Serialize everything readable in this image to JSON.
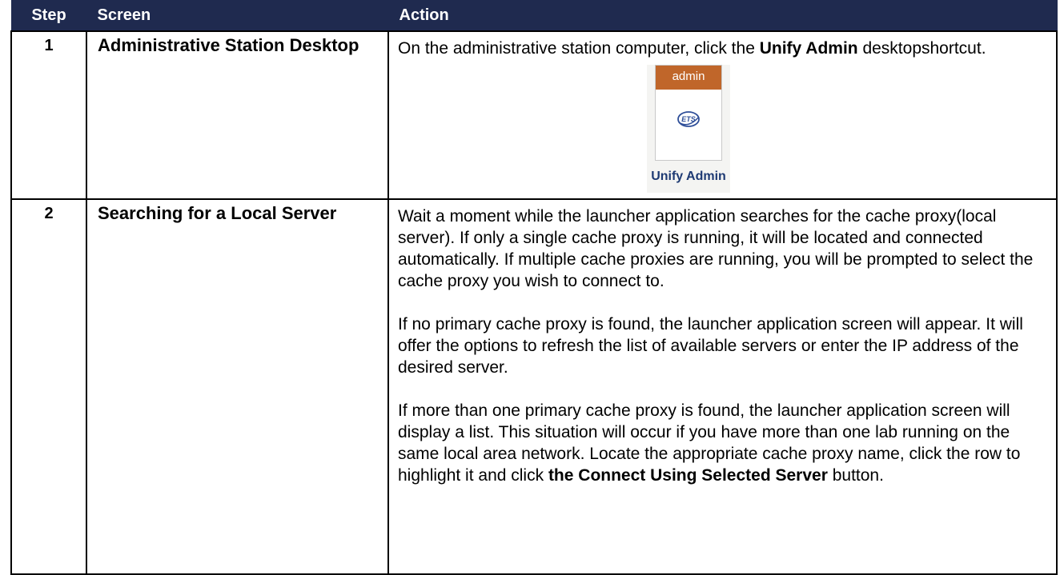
{
  "header": {
    "step": "Step",
    "screen": "Screen",
    "action": "Action"
  },
  "rows": [
    {
      "step": "1",
      "screen": "Administrative Station Desktop",
      "action": {
        "before": "On the administrative station computer, click the ",
        "bold": "Unify Admin",
        "after": " desktopshortcut."
      },
      "icon": {
        "name": "unify-admin-shortcut-icon",
        "head_text": "admin",
        "logo_text": "ETS",
        "label": "Unify Admin",
        "head_color": "#c0662a",
        "label_color": "#1e3a73"
      }
    },
    {
      "step": "2",
      "screen": "Searching for a Local Server",
      "paragraphs": {
        "p1": "Wait a moment while the launcher application searches for the cache proxy(local server). If only a single cache proxy is running, it will be located and connected automatically. If multiple cache proxies are running, you will be prompted to select the cache proxy you wish to connect to.",
        "p2": "If no primary cache proxy is found, the launcher application screen will appear. It will offer the options to refresh the list of available servers or enter the IP address of the desired server.",
        "p3_before": "If more than one primary cache proxy is found, the launcher application screen will display a list. This situation will occur if you have more than one lab running on the same local area network. Locate the appropriate cache proxy name, click the row to highlight it and click ",
        "p3_bold": "the Connect Using Selected Server",
        "p3_after": " button."
      }
    }
  ],
  "colors": {
    "header_bg": "#1f2a4f",
    "header_text": "#ffffff",
    "border": "#000000"
  }
}
